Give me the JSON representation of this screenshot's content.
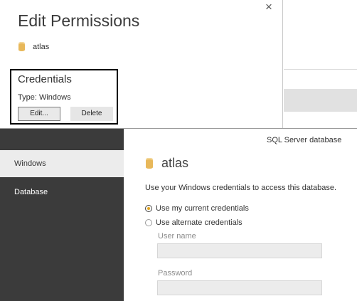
{
  "edit_permissions": {
    "title": "Edit Permissions",
    "close_glyph": "×",
    "database_name": "atlas",
    "credentials": {
      "heading": "Credentials",
      "type_text": "Type: Windows",
      "edit_label": "Edit...",
      "delete_label": "Delete"
    }
  },
  "sql_dialog": {
    "header": "SQL Server database",
    "sidebar": {
      "items": [
        {
          "label": "Windows",
          "active": true
        },
        {
          "label": "Database",
          "active": false
        }
      ]
    },
    "database_name": "atlas",
    "description": "Use your Windows credentials to access this database.",
    "options": [
      {
        "label": "Use my current credentials",
        "selected": true
      },
      {
        "label": "Use alternate credentials",
        "selected": false
      }
    ],
    "username": {
      "label": "User name",
      "value": ""
    },
    "password": {
      "label": "Password",
      "value": ""
    }
  },
  "colors": {
    "accent_radio": "#e1a41e",
    "db_icon": "#e8b85a",
    "sidebar_bg": "#3b3b3b",
    "sidebar_active_bg": "#ececec"
  },
  "icons": {
    "close": "close-icon",
    "database": "database-cylinder-icon"
  }
}
